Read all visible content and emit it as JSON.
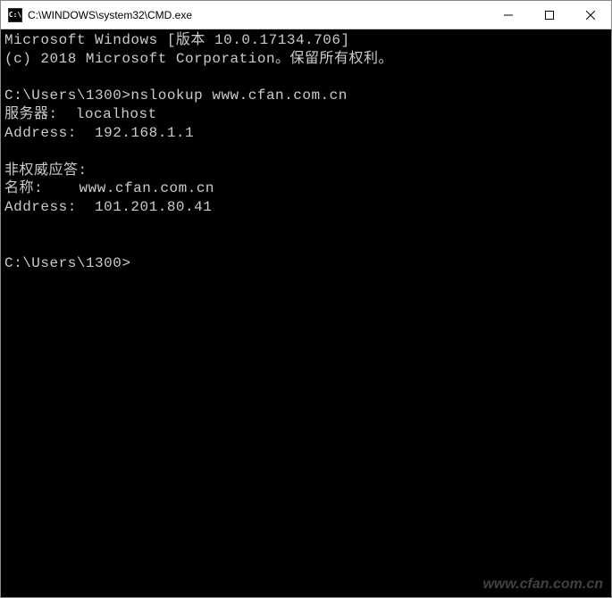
{
  "titlebar": {
    "icon_text": "C:\\",
    "title": "C:\\WINDOWS\\system32\\CMD.exe"
  },
  "terminal": {
    "lines": [
      "Microsoft Windows [版本 10.0.17134.706]",
      "(c) 2018 Microsoft Corporation。保留所有权利。",
      "",
      "C:\\Users\\1300>nslookup www.cfan.com.cn",
      "服务器:  localhost",
      "Address:  192.168.1.1",
      "",
      "非权威应答:",
      "名称:    www.cfan.com.cn",
      "Address:  101.201.80.41",
      "",
      "",
      "C:\\Users\\1300>"
    ]
  },
  "watermark": "www.cfan.com.cn"
}
